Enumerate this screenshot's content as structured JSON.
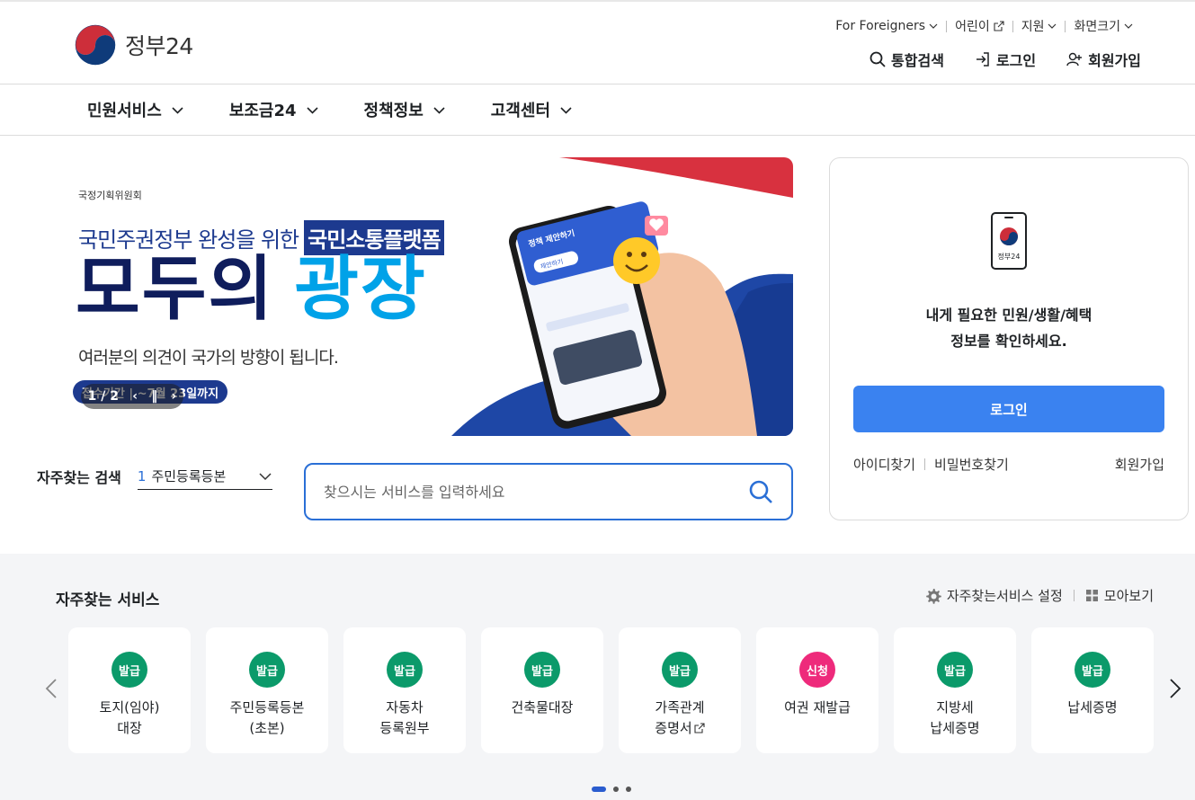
{
  "header": {
    "logo_text": "정부24",
    "util": [
      {
        "label": "For Foreigners",
        "icon": "chevron-down-icon"
      },
      {
        "label": "어린이",
        "icon": "external-link-icon"
      },
      {
        "label": "지원",
        "icon": "chevron-down-icon"
      },
      {
        "label": "화면크기",
        "icon": "chevron-down-icon"
      }
    ],
    "main_links": [
      {
        "label": "통합검색",
        "icon": "search-icon"
      },
      {
        "label": "로그인",
        "icon": "login-icon"
      },
      {
        "label": "회원가입",
        "icon": "add-user-icon"
      }
    ]
  },
  "gnb": [
    "민원서비스",
    "보조금24",
    "정책정보",
    "고객센터"
  ],
  "banner": {
    "org": "국정기획위원회",
    "line1_pre": "국민주권정부 완성을 위한",
    "line1_highlight": "국민소통플랫폼",
    "big_a": "모두의",
    "big_b": "광장",
    "line3": "여러분의 의견이 국가의 방향이 됩니다.",
    "period": "접수기간 | ~7월 23일까지",
    "pager": "1 / 2",
    "phone_card_title": "정책 제안하기",
    "phone_card_btn": "제안하기"
  },
  "quick_search": {
    "label": "자주찾는 검색",
    "selected_num": "1",
    "selected": "주민등록등본"
  },
  "search": {
    "placeholder": "찾으시는 서비스를 입력하세요"
  },
  "login_box": {
    "phone_label": "정부24",
    "message_line1": "내게 필요한 민원/생활/혜택",
    "message_line2": "정보를 확인하세요.",
    "button": "로그인",
    "find_id": "아이디찾기",
    "find_pw": "비밀번호찾기",
    "signup": "회원가입"
  },
  "services": {
    "title": "자주찾는 서비스",
    "settings": "자주찾는서비스 설정",
    "view_all": "모아보기",
    "colors": {
      "issue": "#0b9a6a",
      "apply": "#ee2a7b"
    },
    "cards": [
      {
        "badge": "발급",
        "name": "토지(임야)\n대장"
      },
      {
        "badge": "발급",
        "name": "주민등록등본\n(초본)"
      },
      {
        "badge": "발급",
        "name": "자동차\n등록원부"
      },
      {
        "badge": "발급",
        "name": "건축물대장"
      },
      {
        "badge": "발급",
        "name": "가족관계\n증명서"
      },
      {
        "badge": "신청",
        "name": "여권 재발급"
      },
      {
        "badge": "발급",
        "name": "지방세\n납세증명"
      },
      {
        "badge": "발급",
        "name": "납세증명"
      }
    ]
  }
}
